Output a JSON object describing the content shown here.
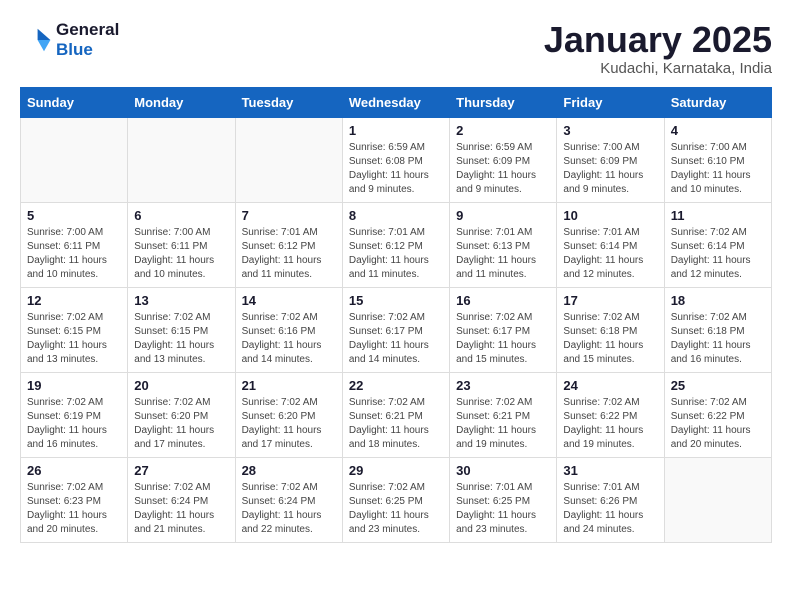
{
  "logo": {
    "line1": "General",
    "line2": "Blue"
  },
  "header": {
    "title": "January 2025",
    "subtitle": "Kudachi, Karnataka, India"
  },
  "weekdays": [
    "Sunday",
    "Monday",
    "Tuesday",
    "Wednesday",
    "Thursday",
    "Friday",
    "Saturday"
  ],
  "weeks": [
    [
      {
        "day": "",
        "info": ""
      },
      {
        "day": "",
        "info": ""
      },
      {
        "day": "",
        "info": ""
      },
      {
        "day": "1",
        "info": "Sunrise: 6:59 AM\nSunset: 6:08 PM\nDaylight: 11 hours\nand 9 minutes."
      },
      {
        "day": "2",
        "info": "Sunrise: 6:59 AM\nSunset: 6:09 PM\nDaylight: 11 hours\nand 9 minutes."
      },
      {
        "day": "3",
        "info": "Sunrise: 7:00 AM\nSunset: 6:09 PM\nDaylight: 11 hours\nand 9 minutes."
      },
      {
        "day": "4",
        "info": "Sunrise: 7:00 AM\nSunset: 6:10 PM\nDaylight: 11 hours\nand 10 minutes."
      }
    ],
    [
      {
        "day": "5",
        "info": "Sunrise: 7:00 AM\nSunset: 6:11 PM\nDaylight: 11 hours\nand 10 minutes."
      },
      {
        "day": "6",
        "info": "Sunrise: 7:00 AM\nSunset: 6:11 PM\nDaylight: 11 hours\nand 10 minutes."
      },
      {
        "day": "7",
        "info": "Sunrise: 7:01 AM\nSunset: 6:12 PM\nDaylight: 11 hours\nand 11 minutes."
      },
      {
        "day": "8",
        "info": "Sunrise: 7:01 AM\nSunset: 6:12 PM\nDaylight: 11 hours\nand 11 minutes."
      },
      {
        "day": "9",
        "info": "Sunrise: 7:01 AM\nSunset: 6:13 PM\nDaylight: 11 hours\nand 11 minutes."
      },
      {
        "day": "10",
        "info": "Sunrise: 7:01 AM\nSunset: 6:14 PM\nDaylight: 11 hours\nand 12 minutes."
      },
      {
        "day": "11",
        "info": "Sunrise: 7:02 AM\nSunset: 6:14 PM\nDaylight: 11 hours\nand 12 minutes."
      }
    ],
    [
      {
        "day": "12",
        "info": "Sunrise: 7:02 AM\nSunset: 6:15 PM\nDaylight: 11 hours\nand 13 minutes."
      },
      {
        "day": "13",
        "info": "Sunrise: 7:02 AM\nSunset: 6:15 PM\nDaylight: 11 hours\nand 13 minutes."
      },
      {
        "day": "14",
        "info": "Sunrise: 7:02 AM\nSunset: 6:16 PM\nDaylight: 11 hours\nand 14 minutes."
      },
      {
        "day": "15",
        "info": "Sunrise: 7:02 AM\nSunset: 6:17 PM\nDaylight: 11 hours\nand 14 minutes."
      },
      {
        "day": "16",
        "info": "Sunrise: 7:02 AM\nSunset: 6:17 PM\nDaylight: 11 hours\nand 15 minutes."
      },
      {
        "day": "17",
        "info": "Sunrise: 7:02 AM\nSunset: 6:18 PM\nDaylight: 11 hours\nand 15 minutes."
      },
      {
        "day": "18",
        "info": "Sunrise: 7:02 AM\nSunset: 6:18 PM\nDaylight: 11 hours\nand 16 minutes."
      }
    ],
    [
      {
        "day": "19",
        "info": "Sunrise: 7:02 AM\nSunset: 6:19 PM\nDaylight: 11 hours\nand 16 minutes."
      },
      {
        "day": "20",
        "info": "Sunrise: 7:02 AM\nSunset: 6:20 PM\nDaylight: 11 hours\nand 17 minutes."
      },
      {
        "day": "21",
        "info": "Sunrise: 7:02 AM\nSunset: 6:20 PM\nDaylight: 11 hours\nand 17 minutes."
      },
      {
        "day": "22",
        "info": "Sunrise: 7:02 AM\nSunset: 6:21 PM\nDaylight: 11 hours\nand 18 minutes."
      },
      {
        "day": "23",
        "info": "Sunrise: 7:02 AM\nSunset: 6:21 PM\nDaylight: 11 hours\nand 19 minutes."
      },
      {
        "day": "24",
        "info": "Sunrise: 7:02 AM\nSunset: 6:22 PM\nDaylight: 11 hours\nand 19 minutes."
      },
      {
        "day": "25",
        "info": "Sunrise: 7:02 AM\nSunset: 6:22 PM\nDaylight: 11 hours\nand 20 minutes."
      }
    ],
    [
      {
        "day": "26",
        "info": "Sunrise: 7:02 AM\nSunset: 6:23 PM\nDaylight: 11 hours\nand 20 minutes."
      },
      {
        "day": "27",
        "info": "Sunrise: 7:02 AM\nSunset: 6:24 PM\nDaylight: 11 hours\nand 21 minutes."
      },
      {
        "day": "28",
        "info": "Sunrise: 7:02 AM\nSunset: 6:24 PM\nDaylight: 11 hours\nand 22 minutes."
      },
      {
        "day": "29",
        "info": "Sunrise: 7:02 AM\nSunset: 6:25 PM\nDaylight: 11 hours\nand 23 minutes."
      },
      {
        "day": "30",
        "info": "Sunrise: 7:01 AM\nSunset: 6:25 PM\nDaylight: 11 hours\nand 23 minutes."
      },
      {
        "day": "31",
        "info": "Sunrise: 7:01 AM\nSunset: 6:26 PM\nDaylight: 11 hours\nand 24 minutes."
      },
      {
        "day": "",
        "info": ""
      }
    ]
  ]
}
